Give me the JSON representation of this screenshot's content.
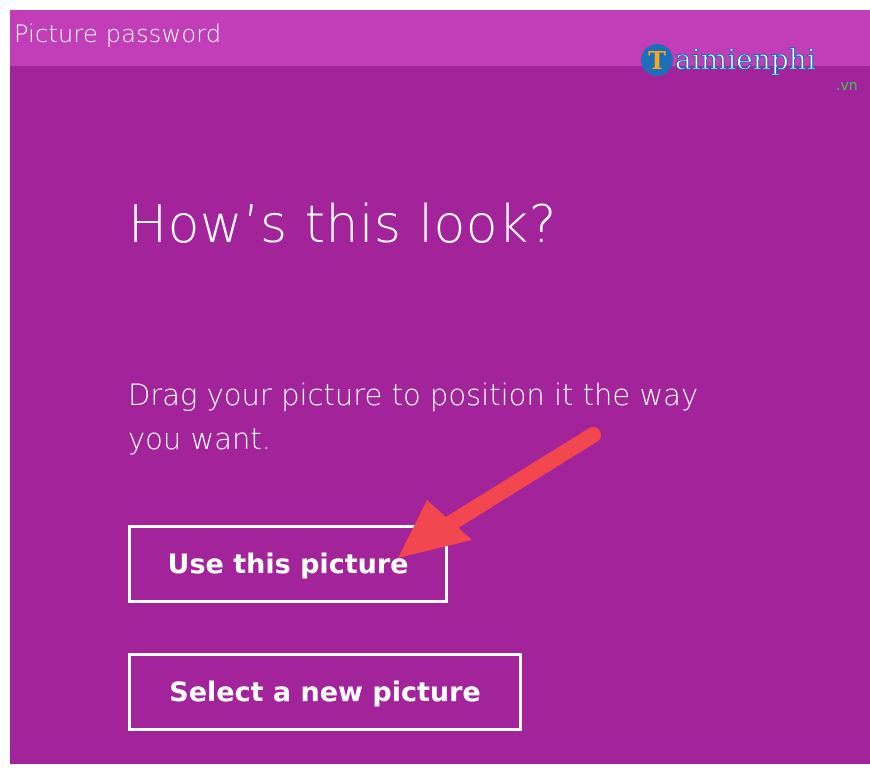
{
  "window": {
    "title": "Picture password"
  },
  "watermark": {
    "initial": "T",
    "brand": "aimienphi",
    "domain": ".vn"
  },
  "main": {
    "heading": "How’s this look?",
    "description": "Drag your picture to position it the way you want.",
    "use_button_label": "Use this picture",
    "select_button_label": "Select a new picture"
  },
  "annotation": {
    "arrow_color": "#f2474f"
  },
  "colors": {
    "background": "#a2239a",
    "titlebar": "#c23db8",
    "text": "#ffffff"
  }
}
